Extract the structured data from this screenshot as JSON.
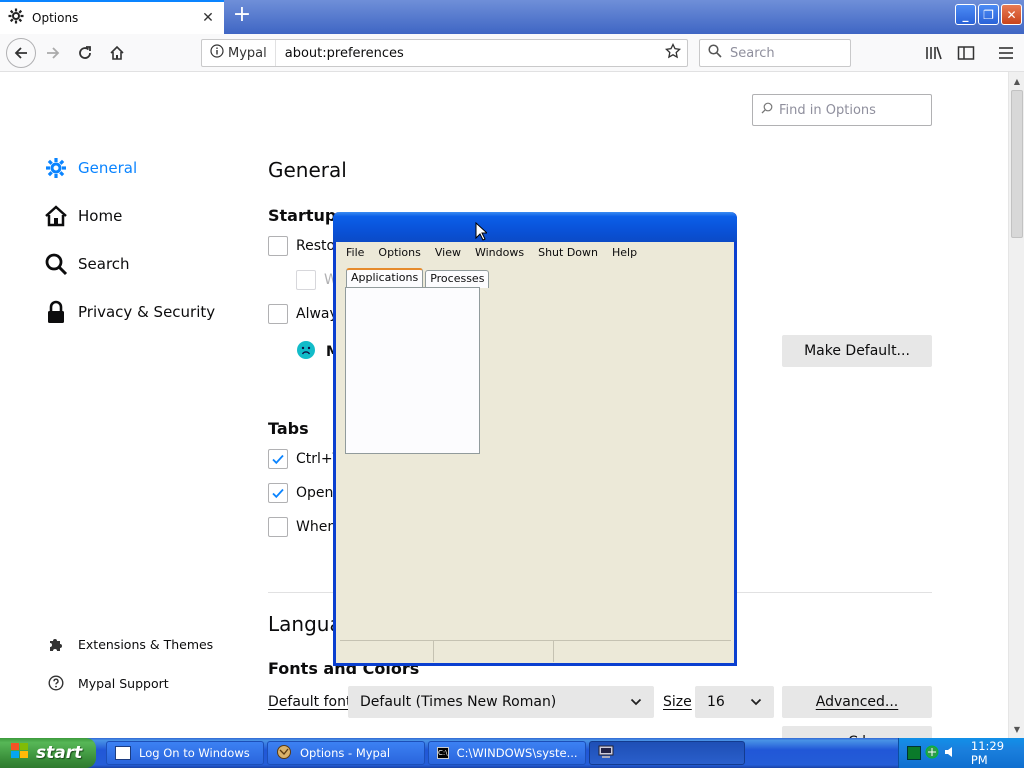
{
  "browser": {
    "tab_title": "Options",
    "identity_label": "Mypal",
    "url": "about:preferences",
    "search_placeholder": "Search"
  },
  "prefs": {
    "find_placeholder": "Find in Options",
    "categories": [
      {
        "label": "General",
        "icon": "gear-icon",
        "selected": true
      },
      {
        "label": "Home",
        "icon": "home-icon"
      },
      {
        "label": "Search",
        "icon": "search-icon"
      },
      {
        "label": "Privacy & Security",
        "icon": "lock-icon"
      }
    ],
    "footer_links": [
      {
        "label": "Extensions & Themes",
        "icon": "puzzle-icon"
      },
      {
        "label": "Mypal Support",
        "icon": "help-icon"
      }
    ],
    "page_title": "General",
    "startup": {
      "heading": "Startup",
      "restore_label": "Restor",
      "warn_label": "W",
      "always_label": "Always",
      "default_browser_label": "M",
      "make_default_button": "Make Default..."
    },
    "tabs": {
      "heading": "Tabs",
      "ctrl_tab_label": "Ctrl+T",
      "open_label": "Open",
      "when_label": "When"
    },
    "language": {
      "heading": "Langua",
      "fonts_heading": "Fonts and Colors",
      "default_font_label": "Default font",
      "default_font_value": "Default (Times New Roman)",
      "size_label": "Size",
      "size_value": "16",
      "advanced_button": "Advanced...",
      "colors_button_partial": "C l"
    }
  },
  "task_manager": {
    "menu": [
      "File",
      "Options",
      "View",
      "Windows",
      "Shut Down",
      "Help"
    ],
    "tabs": [
      "Applications",
      "Processes"
    ]
  },
  "taskbar": {
    "start_label": "start",
    "items": [
      {
        "label": "Log On to Windows"
      },
      {
        "label": "Options - Mypal"
      },
      {
        "label": "C:\\WINDOWS\\syste..."
      }
    ],
    "clock": "11:29 PM"
  }
}
